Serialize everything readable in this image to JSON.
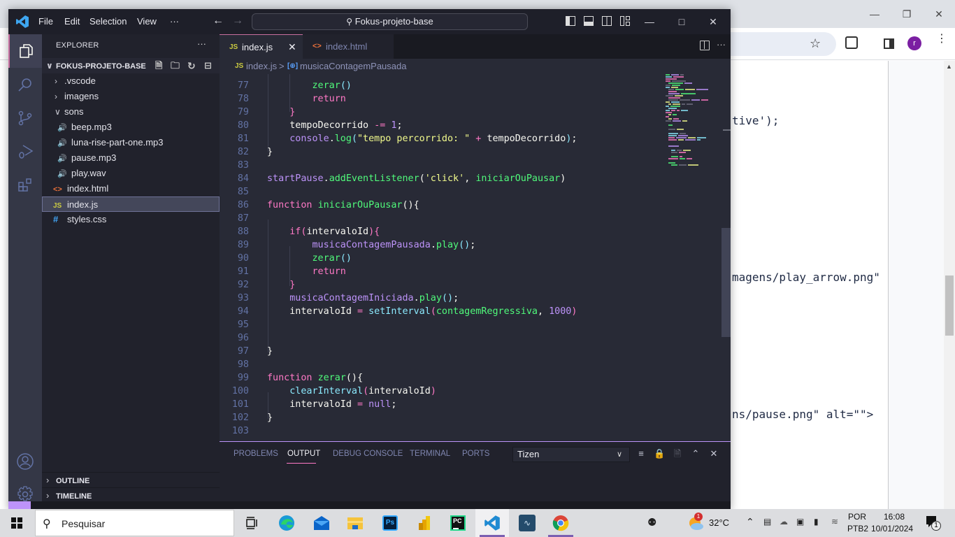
{
  "chrome": {
    "page_code_lines": [
      {
        "text": "tive');"
      },
      {
        "text": "magens/play_arrow.png\""
      },
      {
        "text": "ns/pause.png\" alt=\"\">"
      }
    ],
    "avatar_letter": "r",
    "colors": {
      "avatar": "#7b1fa2"
    }
  },
  "vscode": {
    "menu": [
      "File",
      "Edit",
      "Selection",
      "View",
      "···"
    ],
    "command_center": "Fokus-projeto-base",
    "explorer_title": "EXPLORER",
    "explorer_more": "···",
    "project_name": "FOKUS-PROJETO-BASE",
    "tree": [
      {
        "label": ".vscode",
        "type": "folder",
        "expanded": false
      },
      {
        "label": "imagens",
        "type": "folder",
        "expanded": false
      },
      {
        "label": "sons",
        "type": "folder",
        "expanded": true
      },
      {
        "label": "beep.mp3",
        "type": "audio"
      },
      {
        "label": "luna-rise-part-one.mp3",
        "type": "audio"
      },
      {
        "label": "pause.mp3",
        "type": "audio"
      },
      {
        "label": "play.wav",
        "type": "audio"
      },
      {
        "label": "index.html",
        "type": "html"
      },
      {
        "label": "index.js",
        "type": "js",
        "selected": true
      },
      {
        "label": "styles.css",
        "type": "css"
      }
    ],
    "sections": [
      "OUTLINE",
      "TIMELINE"
    ],
    "tabs": [
      {
        "label": "index.js",
        "icon": "JS",
        "active": true
      },
      {
        "label": "index.html",
        "icon": "<>",
        "active": false
      }
    ],
    "breadcrumb": {
      "file": "index.js",
      "separator": ">",
      "symbol": "musicaContagemPausada"
    },
    "code": [
      {
        "n": "77",
        "tokens": [
          [
            "        ",
            ""
          ],
          [
            "zerar",
            "fn"
          ],
          [
            "()",
            "p"
          ]
        ]
      },
      {
        "n": "78",
        "tokens": [
          [
            "        ",
            ""
          ],
          [
            "return",
            "kw"
          ]
        ]
      },
      {
        "n": "79",
        "tokens": [
          [
            "    ",
            ""
          ],
          [
            "}",
            "kw"
          ]
        ]
      },
      {
        "n": "80",
        "tokens": [
          [
            "    ",
            ""
          ],
          [
            "tempoDecorrido ",
            "id"
          ],
          [
            "-=",
            "kw"
          ],
          [
            " ",
            ""
          ],
          [
            "1",
            "num"
          ],
          [
            ";",
            "id"
          ]
        ]
      },
      {
        "n": "81",
        "tokens": [
          [
            "    ",
            ""
          ],
          [
            "console",
            "obj"
          ],
          [
            ".",
            "id"
          ],
          [
            "log",
            "fn"
          ],
          [
            "(",
            "p"
          ],
          [
            "\"tempo percorrido: \"",
            "str"
          ],
          [
            " + ",
            "kw"
          ],
          [
            "tempoDecorrido",
            "id"
          ],
          [
            ")",
            "p"
          ],
          [
            ";",
            "id"
          ]
        ]
      },
      {
        "n": "82",
        "tokens": [
          [
            "}",
            "id"
          ]
        ]
      },
      {
        "n": "83",
        "tokens": []
      },
      {
        "n": "84",
        "tokens": [
          [
            "startPause",
            "obj"
          ],
          [
            ".",
            "id"
          ],
          [
            "addEventListener",
            "fn"
          ],
          [
            "(",
            "id"
          ],
          [
            "'click'",
            "str"
          ],
          [
            ", ",
            "id"
          ],
          [
            "iniciarOuPausar",
            "fn"
          ],
          [
            ")",
            "id"
          ]
        ]
      },
      {
        "n": "85",
        "tokens": []
      },
      {
        "n": "86",
        "tokens": [
          [
            "function ",
            "kw"
          ],
          [
            "iniciarOuPausar",
            "fn"
          ],
          [
            "(){",
            "id"
          ]
        ]
      },
      {
        "n": "87",
        "tokens": []
      },
      {
        "n": "88",
        "tokens": [
          [
            "    ",
            ""
          ],
          [
            "if",
            "kw"
          ],
          [
            "(",
            "kw"
          ],
          [
            "intervaloId",
            "id"
          ],
          [
            "){",
            "kw"
          ]
        ]
      },
      {
        "n": "89",
        "tokens": [
          [
            "        ",
            ""
          ],
          [
            "musicaContagemPausada",
            "obj"
          ],
          [
            ".",
            "id"
          ],
          [
            "play",
            "fn"
          ],
          [
            "()",
            "p"
          ],
          [
            ";",
            "id"
          ]
        ]
      },
      {
        "n": "90",
        "tokens": [
          [
            "        ",
            ""
          ],
          [
            "zerar",
            "fn"
          ],
          [
            "()",
            "p"
          ]
        ]
      },
      {
        "n": "91",
        "tokens": [
          [
            "        ",
            ""
          ],
          [
            "return",
            "kw"
          ]
        ]
      },
      {
        "n": "92",
        "tokens": [
          [
            "    ",
            ""
          ],
          [
            "}",
            "kw"
          ]
        ]
      },
      {
        "n": "93",
        "tokens": [
          [
            "    ",
            ""
          ],
          [
            "musicaContagemIniciada",
            "obj"
          ],
          [
            ".",
            "id"
          ],
          [
            "play",
            "fn"
          ],
          [
            "()",
            "p"
          ],
          [
            ";",
            "id"
          ]
        ]
      },
      {
        "n": "94",
        "tokens": [
          [
            "    ",
            ""
          ],
          [
            "intervaloId ",
            "id"
          ],
          [
            "= ",
            "kw"
          ],
          [
            "setInterval",
            "cyan"
          ],
          [
            "(",
            "kw"
          ],
          [
            "contagemRegressiva",
            "fn"
          ],
          [
            ", ",
            "id"
          ],
          [
            "1000",
            "num"
          ],
          [
            ")",
            "kw"
          ]
        ]
      },
      {
        "n": "95",
        "tokens": []
      },
      {
        "n": "96",
        "tokens": []
      },
      {
        "n": "97",
        "tokens": [
          [
            "}",
            "id"
          ]
        ]
      },
      {
        "n": "98",
        "tokens": []
      },
      {
        "n": "99",
        "tokens": [
          [
            "function ",
            "kw"
          ],
          [
            "zerar",
            "fn"
          ],
          [
            "(){",
            "id"
          ]
        ]
      },
      {
        "n": "100",
        "tokens": [
          [
            "    ",
            ""
          ],
          [
            "clearInterval",
            "cyan"
          ],
          [
            "(",
            "kw"
          ],
          [
            "intervaloId",
            "id"
          ],
          [
            ")",
            "kw"
          ]
        ]
      },
      {
        "n": "101",
        "tokens": [
          [
            "    ",
            ""
          ],
          [
            "intervaloId ",
            "id"
          ],
          [
            "= ",
            "kw"
          ],
          [
            "null",
            "num"
          ],
          [
            ";",
            "id"
          ]
        ]
      },
      {
        "n": "102",
        "tokens": [
          [
            "}",
            "id"
          ]
        ]
      },
      {
        "n": "103",
        "tokens": []
      }
    ],
    "panel": {
      "tabs": [
        "PROBLEMS",
        "OUTPUT",
        "DEBUG CONSOLE",
        "TERMINAL",
        "PORTS"
      ],
      "active_tab": "OUTPUT",
      "output_channel": "Tizen"
    },
    "colors": {
      "keyword": "#ff79c6",
      "function": "#50fa7b",
      "string": "#f1fa8c",
      "number": "#bd93f9",
      "object": "#bd93f9",
      "cyan": "#8be9fd",
      "identifier": "#f8f8f2",
      "accent": "#bd93f9"
    }
  },
  "taskbar": {
    "search_placeholder": "Pesquisar",
    "weather": "32°C",
    "weather_badge": "1",
    "language": "POR",
    "layout": "PTB2",
    "time": "16:08",
    "date": "10/01/2024",
    "notification_count": "1",
    "apps": [
      "task-view",
      "edge",
      "mail",
      "file-explorer",
      "photoshop",
      "power-bi",
      "pycharm",
      "vscode",
      "mysql-workbench",
      "chrome"
    ]
  }
}
